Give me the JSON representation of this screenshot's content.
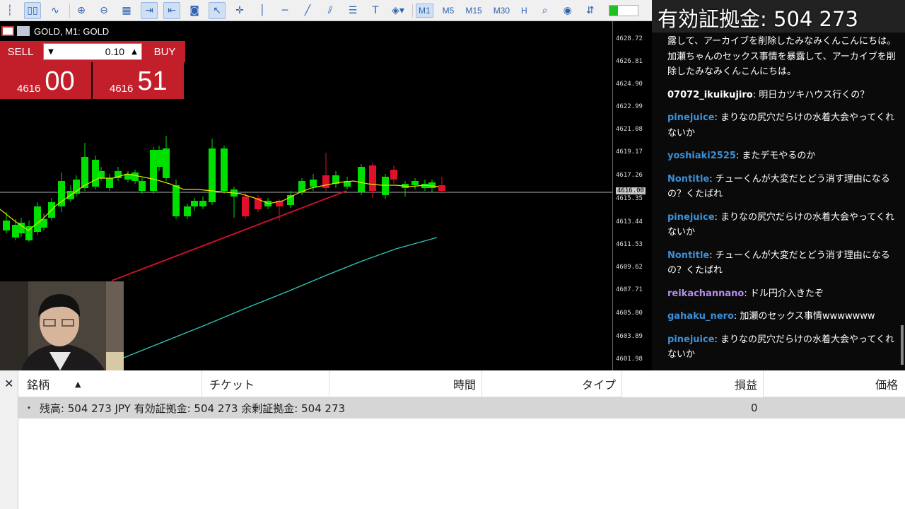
{
  "toolbar": {
    "timeframes": [
      "M1",
      "M5",
      "M15",
      "M30",
      "H"
    ],
    "selected_timeframe": "M1"
  },
  "chart": {
    "title": "GOLD, M1: GOLD",
    "price_ticks": [
      "4628.72",
      "4626.81",
      "4624.90",
      "4622.99",
      "4621.08",
      "4619.17",
      "4617.26",
      "4616.00",
      "4615.35",
      "4613.44",
      "4611.53",
      "4609.62",
      "4607.71",
      "4605.80",
      "4603.89",
      "4601.98"
    ],
    "current_price_label": "4616.00",
    "colors": {
      "bull": "#00e000",
      "bear": "#e0102a",
      "ma_fast": "#e6e600",
      "trend_line": "#c8102a",
      "ma_slow": "#2ec4b6"
    }
  },
  "one_click": {
    "sell_label": "SELL",
    "buy_label": "BUY",
    "lot": "0.10",
    "sell_price_prefix": "4616",
    "sell_price_suffix": "00",
    "buy_price_prefix": "4616",
    "buy_price_suffix": "51"
  },
  "chat": {
    "equity_label": "有効証拠金: 504 273",
    "messages": [
      {
        "user": "",
        "text": "露して、アーカイブを削除したみなみくんこんにちは。加瀬ちゃんのセックス事情を暴露して、アーカイブを削除したみなみくんこんにちは。",
        "color": "#ffffff"
      },
      {
        "user": "07072_ikuikujiro",
        "text": ": 明日カツキハウス行くの？",
        "color": "#ffffff"
      },
      {
        "user": "pinejuice",
        "text": ": まりなの尻穴だらけの水着大会やってくれないか",
        "color": "#3a8fd8"
      },
      {
        "user": "yoshiaki2525",
        "text": ": またデモやるのか",
        "color": "#3a8fd8"
      },
      {
        "user": "Nontitle",
        "text": ": チューくんが大変だとどう消す理由になるの？くたばれ",
        "color": "#3a8fd8"
      },
      {
        "user": "pinejuice",
        "text": ": まりなの尻穴だらけの水着大会やってくれないか",
        "color": "#3a8fd8"
      },
      {
        "user": "Nontitle",
        "text": ": チューくんが大変だとどう消す理由になるの？くたばれ",
        "color": "#3a8fd8"
      },
      {
        "user": "reikachannano",
        "text": ": ドル円介入きたぞ",
        "color": "#b48ee8"
      },
      {
        "user": "gahaku_nero",
        "text": ": 加瀬のセックス事情wwwwwww",
        "color": "#3a8fd8"
      },
      {
        "user": "pinejuice",
        "text": ": まりなの尻穴だらけの水着大会やってくれないか",
        "color": "#3a8fd8"
      }
    ]
  },
  "terminal": {
    "columns": [
      "銘柄",
      "チケット",
      "時間",
      "タイプ",
      "損益",
      "価格"
    ],
    "sort_indicator": "▲",
    "balance_row": "残高: 504 273 JPY  有効証拠金: 504 273  余剰証拠金: 504 273",
    "profit_value": "0"
  }
}
